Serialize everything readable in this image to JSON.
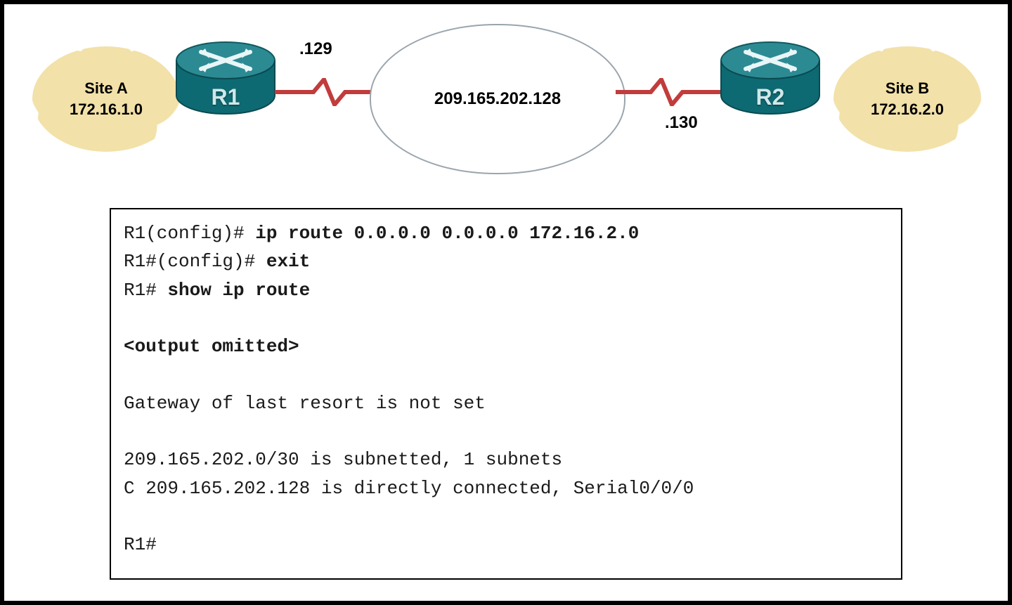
{
  "siteA": {
    "name": "Site A",
    "subnet": "172.16.1.0"
  },
  "siteB": {
    "name": "Site B",
    "subnet": "172.16.2.0"
  },
  "r1": {
    "label": "R1",
    "serialIp": ".129"
  },
  "r2": {
    "label": "R2",
    "serialIp": ".130"
  },
  "wan": {
    "subnet": "209.165.202.128"
  },
  "cli": {
    "l1a": "R1(config)# ",
    "l1b": "ip route 0.0.0.0 0.0.0.0 172.16.2.0",
    "l2a": "R1#(config)# ",
    "l2b": "exit",
    "l3a": "R1# ",
    "l3b": "show ip route",
    "blank": "",
    "l4": "<output omitted>",
    "l5": "Gateway of last resort is not set",
    "l6": "209.165.202.0/30 is subnetted, 1 subnets",
    "l7": "C 209.165.202.128 is directly connected, Serial0/0/0",
    "l8": "R1#"
  }
}
